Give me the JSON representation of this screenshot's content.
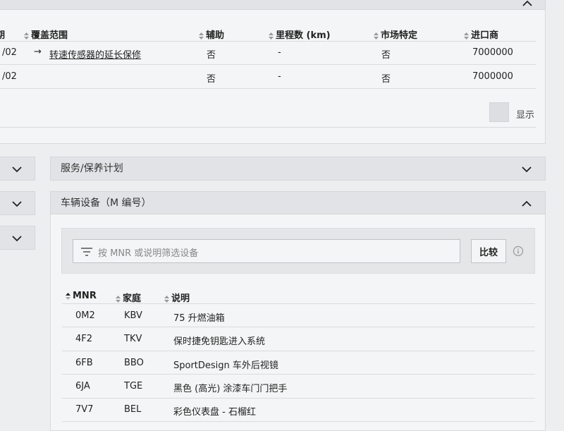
{
  "coverage_table": {
    "headers": [
      "期",
      "覆盖范围",
      "辅助",
      "里程数 (km)",
      "市场特定",
      "进口商"
    ],
    "rows": [
      {
        "date": "/02",
        "arrow": "→",
        "coverage": "转速传感器的延长保修",
        "aux": "否",
        "mileage": "-",
        "market": "否",
        "importer": "7000000"
      },
      {
        "date": "/02",
        "arrow": "",
        "coverage": "",
        "aux": "否",
        "mileage": "-",
        "market": "否",
        "importer": "7000000"
      }
    ],
    "show_label": "显示"
  },
  "service_section": {
    "title": "服务/保养计划"
  },
  "equipment_section": {
    "title": "车辆设备（M 编号）",
    "filter_placeholder": "按 MNR 或说明筛选设备",
    "compare_label": "比较",
    "headers": [
      "MNR",
      "家庭",
      "说明"
    ],
    "rows": [
      {
        "mnr": "0M2",
        "family": "KBV",
        "desc": "75 升燃油箱"
      },
      {
        "mnr": "4F2",
        "family": "TKV",
        "desc": "保时捷免钥匙进入系统"
      },
      {
        "mnr": "6FB",
        "family": "BBO",
        "desc": "SportDesign 车外后视镜"
      },
      {
        "mnr": "6JA",
        "family": "TGE",
        "desc": "黑色 (高光) 涂漆车门门把手"
      },
      {
        "mnr": "7V7",
        "family": "BEL",
        "desc": "彩色仪表盘 - 石榴红"
      }
    ]
  },
  "colors": {
    "background": "#eceef0",
    "panel": "#f4f5f6",
    "bar": "#e1e3e6",
    "text": "#222222"
  }
}
